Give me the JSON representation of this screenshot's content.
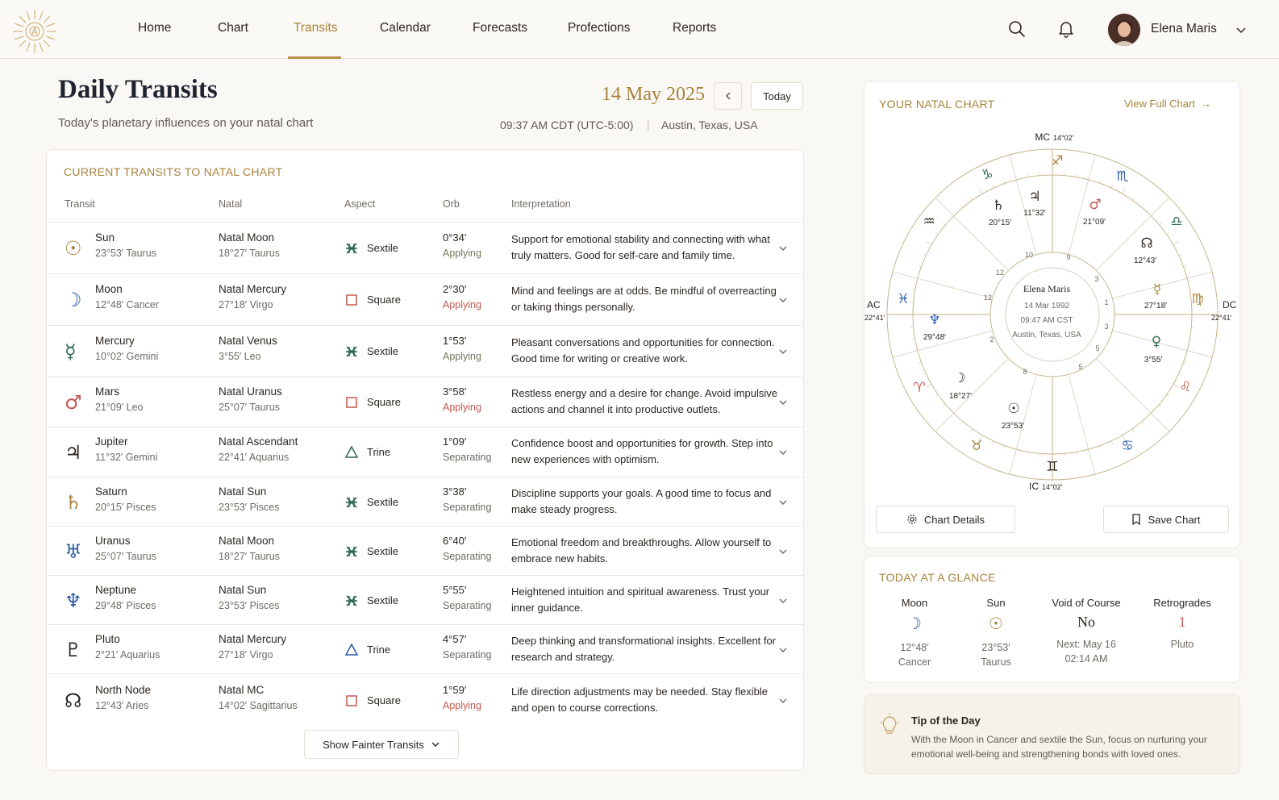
{
  "nav": {
    "items": [
      "Home",
      "Chart",
      "Transits",
      "Calendar",
      "Forecasts",
      "Profections",
      "Reports"
    ],
    "active": "Transits",
    "icons": [
      "search-icon",
      "bell-icon"
    ],
    "user_name": "Elena Maris"
  },
  "header": {
    "title": "Daily Transits",
    "subtitle": "Today's planetary influences on your natal chart",
    "date": "14 May 2025",
    "today_label": "Today",
    "time": "09:37 AM CDT (UTC-5:00)",
    "separator": "|",
    "location": "Austin, Texas, USA"
  },
  "transits": {
    "title": "CURRENT TRANSITS TO NATAL CHART",
    "columns": [
      "Transit",
      "Natal",
      "Aspect",
      "Orb",
      "Interpretation"
    ],
    "rows": [
      {
        "planet": "Sun",
        "pos": "23°53′ Taurus",
        "natal": "Natal Moon",
        "natal_pos": "18°27′ Taurus",
        "aspect": "Sextile",
        "orb": "0°34′",
        "status": "Applying",
        "interp": "Support for emotional stability and connecting with what truly matters. Good for self-care and family time.",
        "icon": "sun-icon"
      },
      {
        "planet": "Moon",
        "pos": "12°48′ Cancer",
        "natal": "Natal Mercury",
        "natal_pos": "27°18′ Virgo",
        "aspect": "Square",
        "orb": "2°30′",
        "status": "Applying",
        "interp": "Mind and feelings are at odds. Be mindful of overreacting or taking things personally.",
        "icon": "moon-icon"
      },
      {
        "planet": "Mercury",
        "pos": "10°02′ Gemini",
        "natal": "Natal Venus",
        "natal_pos": "3°55′ Leo",
        "aspect": "Sextile",
        "orb": "1°53′",
        "status": "Applying",
        "interp": "Pleasant conversations and opportunities for connection. Good time for writing or creative work.",
        "icon": "mercury-icon"
      },
      {
        "planet": "Mars",
        "pos": "21°09′ Leo",
        "natal": "Natal Uranus",
        "natal_pos": "25°07′ Taurus",
        "aspect": "Square",
        "orb": "3°58′",
        "status": "Applying",
        "interp": "Restless energy and a desire for change. Avoid impulsive actions and channel it into productive outlets.",
        "icon": "mars-icon"
      },
      {
        "planet": "Jupiter",
        "pos": "11°32′ Gemini",
        "natal": "Natal Ascendant",
        "natal_pos": "22°41′ Aquarius",
        "aspect": "Trine",
        "orb": "1°09′",
        "status": "Separating",
        "interp": "Confidence boost and opportunities for growth. Step into new experiences with optimism.",
        "icon": "jupiter-icon"
      },
      {
        "planet": "Saturn",
        "pos": "20°15′ Pisces",
        "natal": "Natal Sun",
        "natal_pos": "23°53′ Pisces",
        "aspect": "Sextile",
        "orb": "3°38′",
        "status": "Separating",
        "interp": "Discipline supports your goals. A good time to focus and make steady progress.",
        "icon": "saturn-icon"
      },
      {
        "planet": "Uranus",
        "pos": "25°07′ Taurus",
        "natal": "Natal Moon",
        "natal_pos": "18°27′ Taurus",
        "aspect": "Sextile",
        "orb": "6°40′",
        "status": "Separating",
        "interp": "Emotional freedom and breakthroughs. Allow yourself to embrace new habits.",
        "icon": "uranus-icon"
      },
      {
        "planet": "Neptune",
        "pos": "29°48′ Pisces",
        "natal": "Natal Sun",
        "natal_pos": "23°53′ Pisces",
        "aspect": "Sextile",
        "orb": "5°55′",
        "status": "Separating",
        "interp": "Heightened intuition and spiritual awareness. Trust your inner guidance.",
        "icon": "neptune-icon"
      },
      {
        "planet": "Pluto",
        "pos": "2°21′ Aquarius",
        "natal": "Natal Mercury",
        "natal_pos": "27°18′ Virgo",
        "aspect": "Trine",
        "orb": "4°57′",
        "status": "Separating",
        "interp": "Deep thinking and transformational insights. Excellent for research and strategy.",
        "icon": "pluto-icon"
      },
      {
        "planet": "North Node",
        "pos": "12°43′ Aries",
        "natal": "Natal MC",
        "natal_pos": "14°02′ Sagittarius",
        "aspect": "Square",
        "orb": "1°59′",
        "status": "Applying",
        "interp": "Life direction adjustments may be needed. Stay flexible and open to course corrections.",
        "icon": "north-node-icon"
      }
    ],
    "show_more": "Show Fainter Transits"
  },
  "natal_chart": {
    "title": "YOUR NATAL CHART",
    "view_full": "View Full Chart",
    "center_name": "Elena Maris",
    "center_date": "14 Mar 1992",
    "center_time": "09:47 AM CST",
    "center_place": "Austin, Texas, USA",
    "mc": "MC",
    "mc_deg": "14°02′",
    "ic": "IC",
    "ic_deg": "14°02′",
    "ac": "AC",
    "ac_deg": "22°41′",
    "dc": "DC",
    "dc_deg": "22°41′",
    "house_numbers": [
      "10",
      "9",
      "3",
      "1",
      "3",
      "5",
      "5",
      "8",
      "2",
      "12",
      "12"
    ],
    "planet_labels": [
      "20°15′",
      "11°32′",
      "21°09′",
      "12°43′",
      "27°18′",
      "3°55′",
      "29°48′",
      "18°27′",
      "23°53′"
    ],
    "details_label": "Chart Details",
    "save_label": "Save Chart"
  },
  "glance": {
    "title": "TODAY AT A GLANCE",
    "moon_head": "Moon",
    "moon_deg": "12°48′",
    "moon_sign": "Cancer",
    "sun_head": "Sun",
    "sun_deg": "23°53′",
    "sun_sign": "Taurus",
    "void_head": "Void of Course",
    "void_val": "No",
    "void_next": "Next: May 16",
    "void_time": "02:14 AM",
    "retro_head": "Retrogrades",
    "retro_val": "1",
    "retro_planet": "Pluto"
  },
  "tip": {
    "title": "Tip of the Day",
    "text": "With the Moon in Cancer and sextile the Sun, focus on nurturing your emotional well-being and strengthening bonds with loved ones."
  },
  "colors": {
    "accent": "#a8823b",
    "applying": "#c4574f",
    "trine": "#2e6b4f",
    "sextile": "#2e6b4f",
    "square": "#c4574f"
  }
}
